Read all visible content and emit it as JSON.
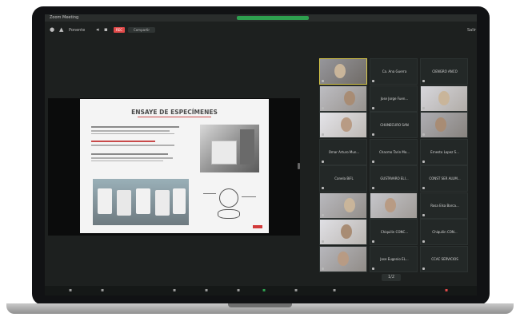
{
  "window": {
    "title": "Zoom Meeting"
  },
  "toolbar": {
    "view_label": "Ponente",
    "rec_label": "REC",
    "pill_label": "Compartir",
    "right_label": "Salir"
  },
  "slide": {
    "title": "ENSAYE DE ESPECÍMENES"
  },
  "participants": [
    {
      "name": "",
      "video": true
    },
    {
      "name": "Ca. Ana Guerra",
      "video": false
    },
    {
      "name": "CIENGRO ANCO",
      "video": false
    },
    {
      "name": "",
      "video": true
    },
    {
      "name": "Jose Jorge Fuen...",
      "video": false
    },
    {
      "name": "",
      "video": true
    },
    {
      "name": "",
      "video": true
    },
    {
      "name": "CHUNECURO SAN",
      "video": false
    },
    {
      "name": "",
      "video": true
    },
    {
      "name": "Omar Arturo Mun...",
      "video": false
    },
    {
      "name": "Chacmo Tarin Mo...",
      "video": false
    },
    {
      "name": "Ernesto Lopez S...",
      "video": false
    },
    {
      "name": "Canela BiFL",
      "video": false
    },
    {
      "name": "GUSTAVARO ELI...",
      "video": false
    },
    {
      "name": "CONST SER ALUM...",
      "video": false
    },
    {
      "name": "",
      "video": true
    },
    {
      "name": "",
      "video": true
    },
    {
      "name": "Rosa Elsa Barca...",
      "video": false
    },
    {
      "name": "",
      "video": true
    },
    {
      "name": "Chiquilin CONC...",
      "video": false
    },
    {
      "name": "Chiquilin CON...",
      "video": false
    },
    {
      "name": "",
      "video": true
    },
    {
      "name": "Jose Eugenio EL...",
      "video": false
    },
    {
      "name": "CCAC SERVICIOS",
      "video": false
    }
  ],
  "gallery": {
    "page_label": "1/2"
  },
  "colors": {
    "accent": "#2ea04f",
    "record": "#e24a4a",
    "background": "#1d201f"
  }
}
